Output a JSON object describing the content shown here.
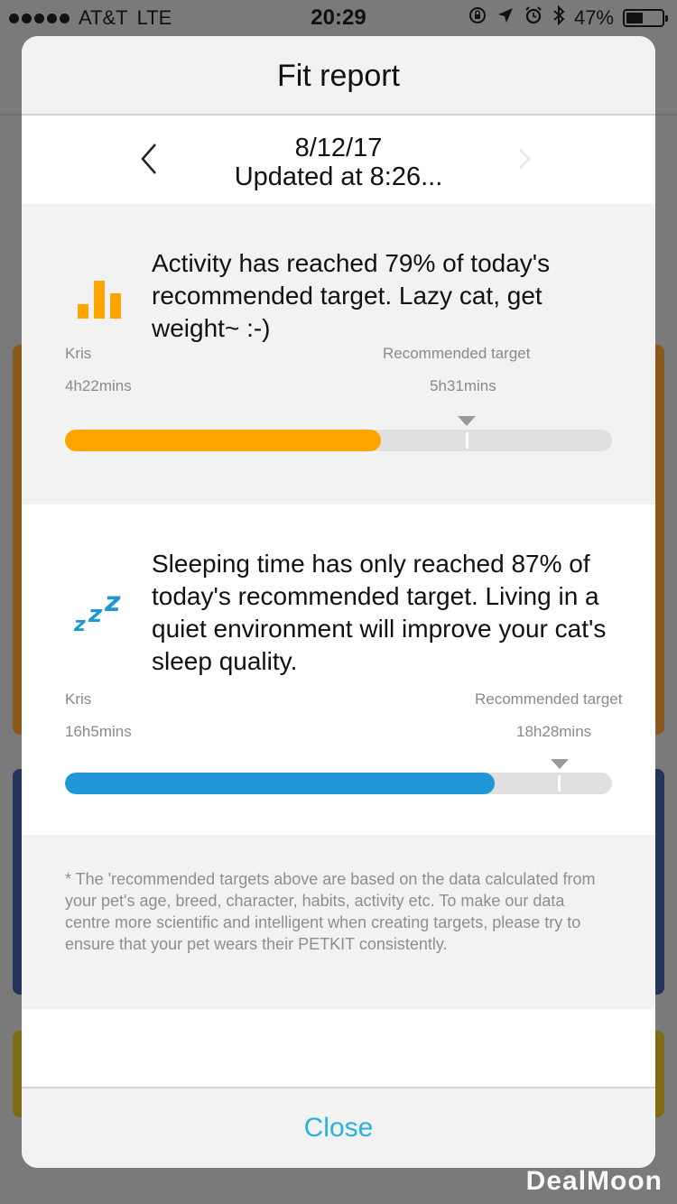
{
  "status_bar": {
    "carrier": "AT&T",
    "network": "LTE",
    "time": "20:29",
    "battery_percent": "47%",
    "battery_level": 0.47
  },
  "modal": {
    "title": "Fit report",
    "date": "8/12/17",
    "updated": "Updated at 8:26..."
  },
  "activity": {
    "message": "Activity has reached 79% of today's recommended target. Lazy cat, get weight~ :-)",
    "pet_name": "Kris",
    "pet_value": "4h22mins",
    "target_label": "Recommended target",
    "target_value": "5h31mins",
    "progress": 0.79,
    "color": "#ffa500"
  },
  "sleep": {
    "message": "Sleeping time has only reached 87% of today's recommended target. Living in a quiet environment will improve your cat's sleep quality.",
    "pet_name": "Kris",
    "pet_value": "16h5mins",
    "target_label": "Recommended target",
    "target_value": "18h28mins",
    "progress": 0.87,
    "color": "#1f96d6"
  },
  "note": "* The 'recommended targets above are based on the data calculated from your pet's age, breed, character, habits, activity etc. To make our data centre more scientific and intelligent when creating targets, please try to ensure that your pet wears their PETKIT consistently.",
  "close_label": "Close",
  "accent_color": "#29b3dc",
  "watermark": "DealMoon"
}
